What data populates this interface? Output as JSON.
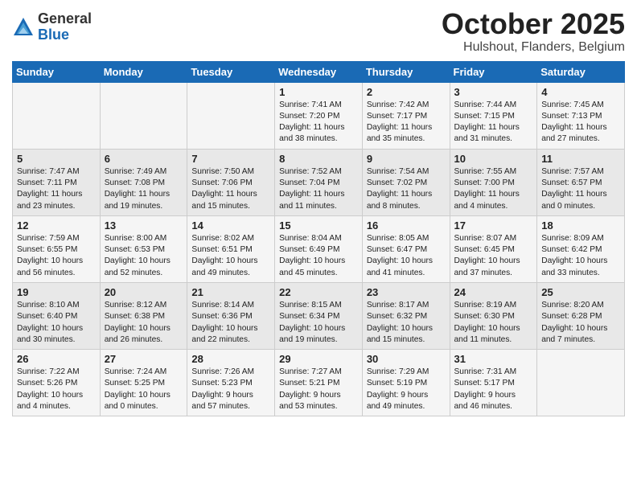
{
  "logo": {
    "general": "General",
    "blue": "Blue"
  },
  "title": "October 2025",
  "location": "Hulshout, Flanders, Belgium",
  "days_header": [
    "Sunday",
    "Monday",
    "Tuesday",
    "Wednesday",
    "Thursday",
    "Friday",
    "Saturday"
  ],
  "weeks": [
    [
      {
        "day": "",
        "info": ""
      },
      {
        "day": "",
        "info": ""
      },
      {
        "day": "",
        "info": ""
      },
      {
        "day": "1",
        "info": "Sunrise: 7:41 AM\nSunset: 7:20 PM\nDaylight: 11 hours\nand 38 minutes."
      },
      {
        "day": "2",
        "info": "Sunrise: 7:42 AM\nSunset: 7:17 PM\nDaylight: 11 hours\nand 35 minutes."
      },
      {
        "day": "3",
        "info": "Sunrise: 7:44 AM\nSunset: 7:15 PM\nDaylight: 11 hours\nand 31 minutes."
      },
      {
        "day": "4",
        "info": "Sunrise: 7:45 AM\nSunset: 7:13 PM\nDaylight: 11 hours\nand 27 minutes."
      }
    ],
    [
      {
        "day": "5",
        "info": "Sunrise: 7:47 AM\nSunset: 7:11 PM\nDaylight: 11 hours\nand 23 minutes."
      },
      {
        "day": "6",
        "info": "Sunrise: 7:49 AM\nSunset: 7:08 PM\nDaylight: 11 hours\nand 19 minutes."
      },
      {
        "day": "7",
        "info": "Sunrise: 7:50 AM\nSunset: 7:06 PM\nDaylight: 11 hours\nand 15 minutes."
      },
      {
        "day": "8",
        "info": "Sunrise: 7:52 AM\nSunset: 7:04 PM\nDaylight: 11 hours\nand 11 minutes."
      },
      {
        "day": "9",
        "info": "Sunrise: 7:54 AM\nSunset: 7:02 PM\nDaylight: 11 hours\nand 8 minutes."
      },
      {
        "day": "10",
        "info": "Sunrise: 7:55 AM\nSunset: 7:00 PM\nDaylight: 11 hours\nand 4 minutes."
      },
      {
        "day": "11",
        "info": "Sunrise: 7:57 AM\nSunset: 6:57 PM\nDaylight: 11 hours\nand 0 minutes."
      }
    ],
    [
      {
        "day": "12",
        "info": "Sunrise: 7:59 AM\nSunset: 6:55 PM\nDaylight: 10 hours\nand 56 minutes."
      },
      {
        "day": "13",
        "info": "Sunrise: 8:00 AM\nSunset: 6:53 PM\nDaylight: 10 hours\nand 52 minutes."
      },
      {
        "day": "14",
        "info": "Sunrise: 8:02 AM\nSunset: 6:51 PM\nDaylight: 10 hours\nand 49 minutes."
      },
      {
        "day": "15",
        "info": "Sunrise: 8:04 AM\nSunset: 6:49 PM\nDaylight: 10 hours\nand 45 minutes."
      },
      {
        "day": "16",
        "info": "Sunrise: 8:05 AM\nSunset: 6:47 PM\nDaylight: 10 hours\nand 41 minutes."
      },
      {
        "day": "17",
        "info": "Sunrise: 8:07 AM\nSunset: 6:45 PM\nDaylight: 10 hours\nand 37 minutes."
      },
      {
        "day": "18",
        "info": "Sunrise: 8:09 AM\nSunset: 6:42 PM\nDaylight: 10 hours\nand 33 minutes."
      }
    ],
    [
      {
        "day": "19",
        "info": "Sunrise: 8:10 AM\nSunset: 6:40 PM\nDaylight: 10 hours\nand 30 minutes."
      },
      {
        "day": "20",
        "info": "Sunrise: 8:12 AM\nSunset: 6:38 PM\nDaylight: 10 hours\nand 26 minutes."
      },
      {
        "day": "21",
        "info": "Sunrise: 8:14 AM\nSunset: 6:36 PM\nDaylight: 10 hours\nand 22 minutes."
      },
      {
        "day": "22",
        "info": "Sunrise: 8:15 AM\nSunset: 6:34 PM\nDaylight: 10 hours\nand 19 minutes."
      },
      {
        "day": "23",
        "info": "Sunrise: 8:17 AM\nSunset: 6:32 PM\nDaylight: 10 hours\nand 15 minutes."
      },
      {
        "day": "24",
        "info": "Sunrise: 8:19 AM\nSunset: 6:30 PM\nDaylight: 10 hours\nand 11 minutes."
      },
      {
        "day": "25",
        "info": "Sunrise: 8:20 AM\nSunset: 6:28 PM\nDaylight: 10 hours\nand 7 minutes."
      }
    ],
    [
      {
        "day": "26",
        "info": "Sunrise: 7:22 AM\nSunset: 5:26 PM\nDaylight: 10 hours\nand 4 minutes."
      },
      {
        "day": "27",
        "info": "Sunrise: 7:24 AM\nSunset: 5:25 PM\nDaylight: 10 hours\nand 0 minutes."
      },
      {
        "day": "28",
        "info": "Sunrise: 7:26 AM\nSunset: 5:23 PM\nDaylight: 9 hours\nand 57 minutes."
      },
      {
        "day": "29",
        "info": "Sunrise: 7:27 AM\nSunset: 5:21 PM\nDaylight: 9 hours\nand 53 minutes."
      },
      {
        "day": "30",
        "info": "Sunrise: 7:29 AM\nSunset: 5:19 PM\nDaylight: 9 hours\nand 49 minutes."
      },
      {
        "day": "31",
        "info": "Sunrise: 7:31 AM\nSunset: 5:17 PM\nDaylight: 9 hours\nand 46 minutes."
      },
      {
        "day": "",
        "info": ""
      }
    ]
  ]
}
